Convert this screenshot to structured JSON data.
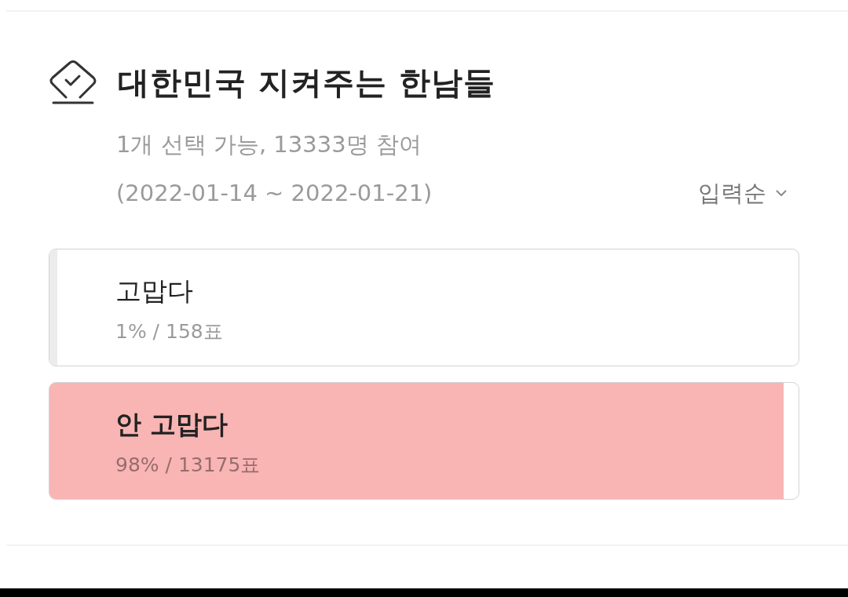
{
  "poll": {
    "title": "대한민국 지켜주는 한남들",
    "summary": "1개 선택 가능, 13333명 참여",
    "period": "(2022-01-14 ~ 2022-01-21)",
    "sort": {
      "label": "입력순"
    },
    "options": [
      {
        "label": "고맙다",
        "result": "1% / 158표",
        "level": 0.01,
        "selected": false
      },
      {
        "label": "안 고맙다",
        "result": "98% / 13175표",
        "level": 0.98,
        "selected": true
      }
    ]
  }
}
